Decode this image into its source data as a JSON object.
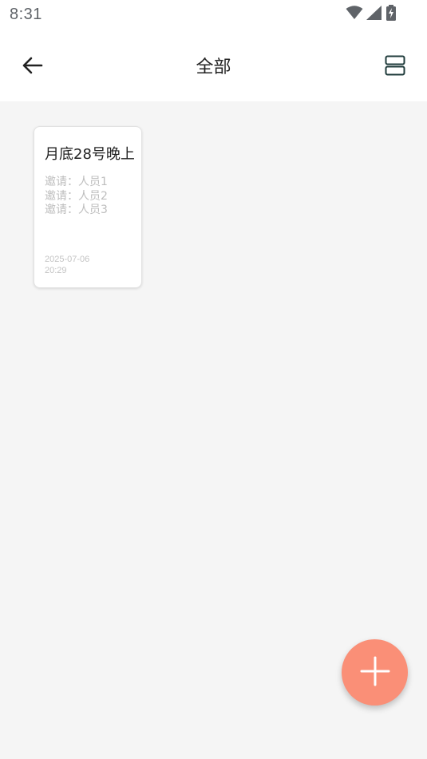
{
  "status_bar": {
    "time": "8:31",
    "icons": [
      "wifi-icon",
      "cellular-signal-icon",
      "battery-charging-icon"
    ]
  },
  "app_bar": {
    "title": "全部",
    "back_icon": "arrow-left-icon",
    "layout_icon": "list-layout-icon"
  },
  "notes": [
    {
      "title": "月底28号晚上",
      "invites": [
        "邀请：人员1",
        "邀请：人员2",
        "邀请：人员3"
      ],
      "date": "2025-07-06 20:29"
    }
  ],
  "fab": {
    "icon": "plus-icon",
    "color": "#fa8f77"
  }
}
